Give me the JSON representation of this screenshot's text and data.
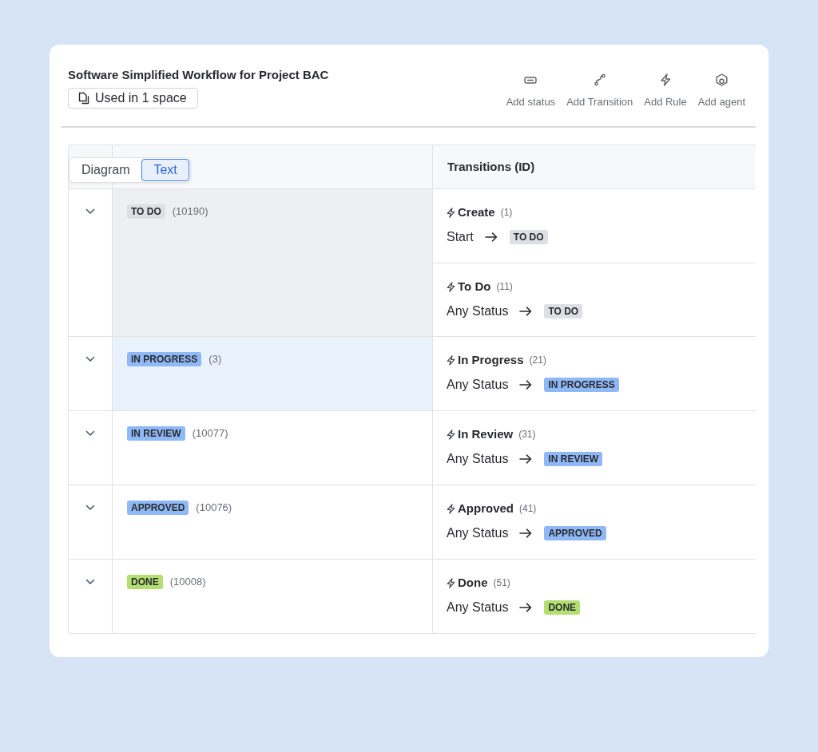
{
  "header": {
    "title": "Software Simplified Workflow for Project BAC",
    "usage_button": "Used in 1 space"
  },
  "toolbar": [
    {
      "kind": "status",
      "label": "Add status"
    },
    {
      "kind": "transition",
      "label": "Add Transition"
    },
    {
      "kind": "rule",
      "label": "Add Rule"
    },
    {
      "kind": "agent",
      "label": "Add agent"
    }
  ],
  "view_toggle": [
    {
      "label": "Diagram",
      "selected": false
    },
    {
      "label": "Text",
      "selected": true
    }
  ],
  "table": {
    "transitions_heading": "Transitions (ID)",
    "rows": [
      {
        "expanded": true,
        "selected": false,
        "hovered": true,
        "status": {
          "label": "TO DO",
          "color": "#dcdfe4"
        },
        "id": "(10190)",
        "transitions": [
          {
            "name": "Create",
            "id": "(1)",
            "from": "Start",
            "to": {
              "label": "TO DO",
              "color": "#dcdfe4"
            }
          },
          {
            "name": "To Do",
            "id": "(11)",
            "from": "Any Status",
            "to": {
              "label": "TO DO",
              "color": "#dcdfe4"
            }
          }
        ]
      },
      {
        "expanded": true,
        "selected": true,
        "hovered": false,
        "status": {
          "label": "IN PROGRESS",
          "color": "#8fb8f6"
        },
        "id": "(3)",
        "transitions": [
          {
            "name": "In Progress",
            "id": "(21)",
            "from": "Any Status",
            "to": {
              "label": "IN PROGRESS",
              "color": "#8fb8f6"
            }
          }
        ]
      },
      {
        "expanded": true,
        "selected": false,
        "hovered": false,
        "status": {
          "label": "IN REVIEW",
          "color": "#8fb8f6"
        },
        "id": "(10077)",
        "transitions": [
          {
            "name": "In Review",
            "id": "(31)",
            "from": "Any Status",
            "to": {
              "label": "IN REVIEW",
              "color": "#8fb8f6"
            }
          }
        ]
      },
      {
        "expanded": true,
        "selected": false,
        "hovered": false,
        "status": {
          "label": "APPROVED",
          "color": "#8fb8f6"
        },
        "id": "(10076)",
        "transitions": [
          {
            "name": "Approved",
            "id": "(41)",
            "from": "Any Status",
            "to": {
              "label": "APPROVED",
              "color": "#8fb8f6"
            }
          }
        ]
      },
      {
        "expanded": true,
        "selected": false,
        "hovered": false,
        "status": {
          "label": "DONE",
          "color": "#b3df72"
        },
        "id": "(10008)",
        "transitions": [
          {
            "name": "Done",
            "id": "(51)",
            "from": "Any Status",
            "to": {
              "label": "DONE",
              "color": "#b3df72"
            }
          }
        ]
      }
    ]
  }
}
